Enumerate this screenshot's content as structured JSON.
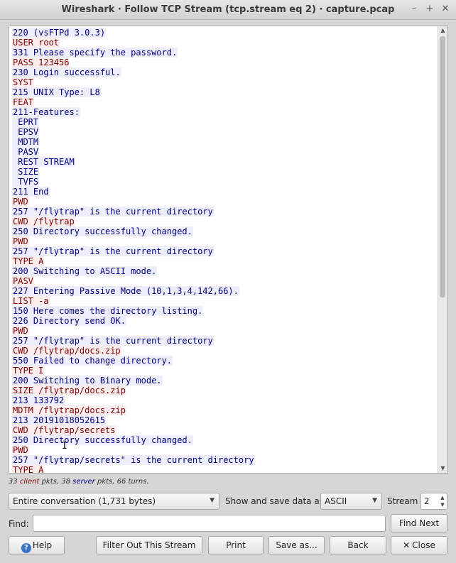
{
  "window": {
    "title": "Wireshark · Follow TCP Stream (tcp.stream eq 2) · capture.pcap",
    "buttons": {
      "minimize": "–",
      "maximize": "+",
      "close": "✕"
    }
  },
  "stream_lines": [
    {
      "dir": "server",
      "text": "220 (vsFTPd 3.0.3)"
    },
    {
      "dir": "client",
      "text": "USER root"
    },
    {
      "dir": "server",
      "text": "331 Please specify the password."
    },
    {
      "dir": "client",
      "text": "PASS 123456"
    },
    {
      "dir": "server",
      "text": "230 Login successful."
    },
    {
      "dir": "client",
      "text": "SYST"
    },
    {
      "dir": "server",
      "text": "215 UNIX Type: L8"
    },
    {
      "dir": "client",
      "text": "FEAT"
    },
    {
      "dir": "server",
      "text": "211-Features:"
    },
    {
      "dir": "server",
      "text": " EPRT"
    },
    {
      "dir": "server",
      "text": " EPSV"
    },
    {
      "dir": "server",
      "text": " MDTM"
    },
    {
      "dir": "server",
      "text": " PASV"
    },
    {
      "dir": "server",
      "text": " REST STREAM"
    },
    {
      "dir": "server",
      "text": " SIZE"
    },
    {
      "dir": "server",
      "text": " TVFS"
    },
    {
      "dir": "server",
      "text": "211 End"
    },
    {
      "dir": "client",
      "text": "PWD"
    },
    {
      "dir": "server",
      "text": "257 \"/flytrap\" is the current directory"
    },
    {
      "dir": "client",
      "text": "CWD /flytrap"
    },
    {
      "dir": "server",
      "text": "250 Directory successfully changed."
    },
    {
      "dir": "client",
      "text": "PWD"
    },
    {
      "dir": "server",
      "text": "257 \"/flytrap\" is the current directory"
    },
    {
      "dir": "client",
      "text": "TYPE A"
    },
    {
      "dir": "server",
      "text": "200 Switching to ASCII mode."
    },
    {
      "dir": "client",
      "text": "PASV"
    },
    {
      "dir": "server",
      "text": "227 Entering Passive Mode (10,1,3,4,142,66)."
    },
    {
      "dir": "client",
      "text": "LIST -a"
    },
    {
      "dir": "server",
      "text": "150 Here comes the directory listing."
    },
    {
      "dir": "server",
      "text": "226 Directory send OK."
    },
    {
      "dir": "client",
      "text": "PWD"
    },
    {
      "dir": "server",
      "text": "257 \"/flytrap\" is the current directory"
    },
    {
      "dir": "client",
      "text": "CWD /flytrap/docs.zip"
    },
    {
      "dir": "server",
      "text": "550 Failed to change directory."
    },
    {
      "dir": "client",
      "text": "TYPE I"
    },
    {
      "dir": "server",
      "text": "200 Switching to Binary mode."
    },
    {
      "dir": "client",
      "text": "SIZE /flytrap/docs.zip"
    },
    {
      "dir": "server",
      "text": "213 133792"
    },
    {
      "dir": "client",
      "text": "MDTM /flytrap/docs.zip"
    },
    {
      "dir": "server",
      "text": "213 20191018052615"
    },
    {
      "dir": "client",
      "text": "CWD /flytrap/secrets"
    },
    {
      "dir": "server",
      "text": "250 Directory successfully changed."
    },
    {
      "dir": "client",
      "text": "PWD"
    },
    {
      "dir": "server",
      "text": "257 \"/flytrap/secrets\" is the current directory"
    },
    {
      "dir": "client",
      "text": "TYPE A"
    }
  ],
  "stats": {
    "client_count": "33",
    "client_word": "client",
    "server_count": "38",
    "server_word": "server",
    "turns": "66 turns.",
    "pkts": "pkts,"
  },
  "controls": {
    "conversation_select": "Entire conversation (1,731 bytes)",
    "show_save_label": "Show and save data as",
    "format_select": "ASCII",
    "stream_label": "Stream",
    "stream_value": "2",
    "find_label": "Find:",
    "find_value": "",
    "find_next": "Find Next"
  },
  "buttons": {
    "help": "Help",
    "filter_out": "Filter Out This Stream",
    "print": "Print",
    "save_as": "Save as...",
    "back": "Back",
    "close": "Close"
  },
  "colors": {
    "client_text": "#7f0000",
    "client_bg": "#fbeded",
    "server_text": "#00007f",
    "server_bg": "#ededfb"
  }
}
